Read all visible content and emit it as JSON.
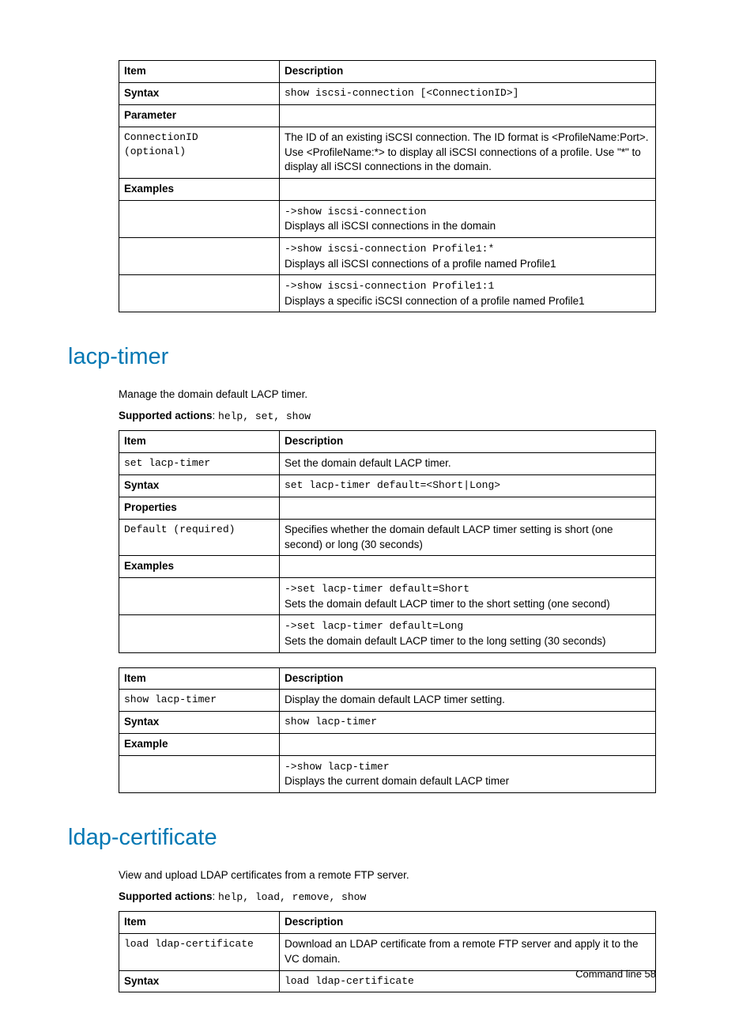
{
  "table1": {
    "h1": "Item",
    "h2": "Description",
    "r_syntax_l": "Syntax",
    "r_syntax_r": "show iscsi-connection [<ConnectionID>]",
    "r_param_l": "Parameter",
    "r_param_r": "",
    "r_cid_l1": "ConnectionID",
    "r_cid_l2": "(optional)",
    "r_cid_r": "The ID of an existing iSCSI connection. The ID format is <ProfileName:Port>. Use <ProfileName:*> to display all iSCSI connections of a profile. Use \"*\" to display all iSCSI connections in the domain.",
    "r_ex_l": "Examples",
    "r_ex_r": "",
    "r_e1_cmd": "->show iscsi-connection",
    "r_e1_txt": "Displays all iSCSI connections in the domain",
    "r_e2_cmd": "->show iscsi-connection Profile1:*",
    "r_e2_txt": "Displays all iSCSI connections of a profile named Profile1",
    "r_e3_cmd": "->show iscsi-connection Profile1:1",
    "r_e3_txt": "Displays a specific iSCSI connection of a profile named Profile1"
  },
  "sec1": {
    "heading": "lacp-timer",
    "intro": "Manage the domain default LACP timer.",
    "sa_label": "Supported actions",
    "sa_value": "help, set, show"
  },
  "table2": {
    "h1": "Item",
    "h2": "Description",
    "r_set_l": "set lacp-timer",
    "r_set_r": "Set the domain default LACP timer.",
    "r_syntax_l": "Syntax",
    "r_syntax_r": "set lacp-timer default=<Short|Long>",
    "r_prop_l": "Properties",
    "r_prop_r": "",
    "r_def_l": "Default (required)",
    "r_def_r": "Specifies whether the domain default LACP timer setting is short (one second) or long (30 seconds)",
    "r_ex_l": "Examples",
    "r_ex_r": "",
    "r_e1_cmd": "->set lacp-timer default=Short",
    "r_e1_txt": "Sets the domain default LACP timer to the short setting (one second)",
    "r_e2_cmd": "->set lacp-timer default=Long",
    "r_e2_txt": "Sets the domain default LACP timer to the long setting (30 seconds)"
  },
  "table3": {
    "h1": "Item",
    "h2": "Description",
    "r_show_l": "show lacp-timer",
    "r_show_r": "Display the domain default LACP timer setting.",
    "r_syntax_l": "Syntax",
    "r_syntax_r": "show lacp-timer",
    "r_ex_l": "Example",
    "r_ex_r": "",
    "r_e1_cmd": "->show lacp-timer",
    "r_e1_txt": "Displays the current domain default LACP timer"
  },
  "sec2": {
    "heading": "ldap-certificate",
    "intro": "View and upload LDAP certificates from a remote FTP server.",
    "sa_label": "Supported actions",
    "sa_value": "help, load, remove, show"
  },
  "table4": {
    "h1": "Item",
    "h2": "Description",
    "r_load_l": "load ldap-certificate",
    "r_load_r": "Download an LDAP certificate from a remote FTP server and apply it to the VC domain.",
    "r_syntax_l": "Syntax",
    "r_syntax_r": "load ldap-certificate"
  },
  "footer": "Command line  58"
}
